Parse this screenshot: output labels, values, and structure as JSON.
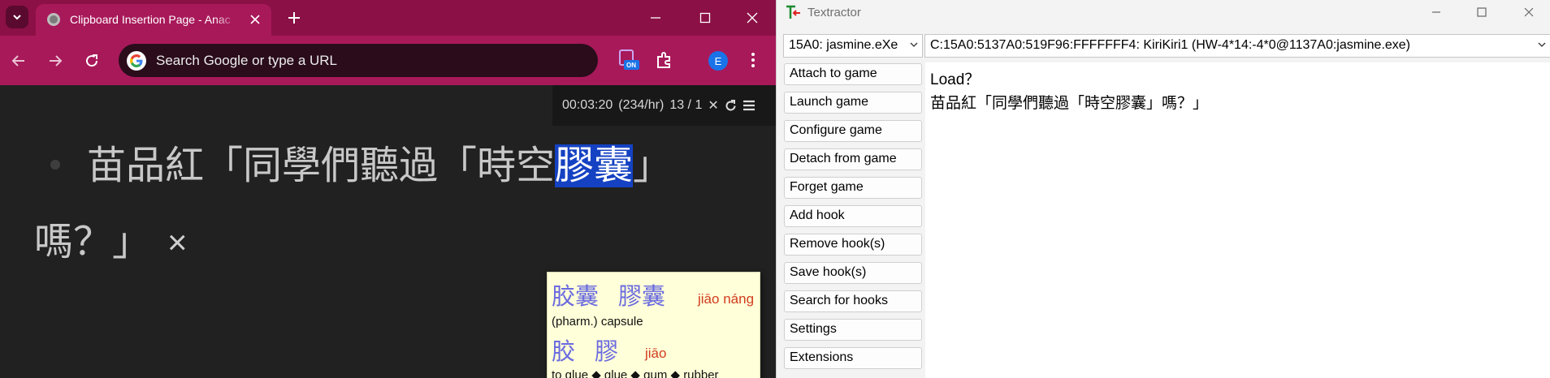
{
  "browser": {
    "tab_title": "Clipboard Insertion Page - Anac",
    "omnibox_placeholder": "Search Google or type a URL",
    "ext_badge": "ON",
    "avatar_initial": "E",
    "status": {
      "timer": "00:03:20",
      "rate": "(234/hr)",
      "count": "13 / 1"
    },
    "line1_before": "苗品紅「同學們聽過「時空",
    "line1_selected": "膠囊",
    "line1_after": "」",
    "line2": "嗎？」",
    "close_symbol": "×",
    "popup": {
      "entry1": {
        "simplified": "胶囊",
        "traditional": "膠囊",
        "pinyin1": "jiāo",
        "pinyin2": "náng",
        "definition": "(pharm.) capsule"
      },
      "entry2": {
        "simplified": "胶",
        "traditional": "膠",
        "pinyin1": "jiāo",
        "definition": "to glue ◆ glue ◆ gum ◆ rubber"
      }
    }
  },
  "textractor": {
    "title": "Textractor",
    "process_selected": "15A0: jasmine.eXe",
    "thread_selected": "C:15A0:5137A0:519F96:FFFFFFF4: KiriKiri1 (HW-4*14:-4*0@1137A0:jasmine.exe)",
    "buttons": [
      "Attach to game",
      "Launch game",
      "Configure game",
      "Detach from game",
      "Forget game",
      "Add hook",
      "Remove hook(s)",
      "Save hook(s)",
      "Search for hooks",
      "Settings",
      "Extensions"
    ],
    "text_lines": [
      "Load？",
      "苗品紅「同學們聽過「時空膠囊」嗎？」"
    ]
  },
  "colors": {
    "browser_frame": "#8b1046",
    "browser_toolbar": "#a8195a",
    "page_bg": "#212121",
    "selection": "#1542c2",
    "popup_bg": "#ffffd9",
    "popup_word": "#6a6ae0",
    "popup_pinyin": "#d23c1f"
  },
  "icons": [
    "chevron-down-icon",
    "close-icon",
    "plus-icon",
    "minimize-icon",
    "maximize-icon",
    "back-icon",
    "forward-icon",
    "reload-icon",
    "google-icon",
    "extension-on-icon",
    "puzzle-icon",
    "kebab-icon",
    "refresh-icon",
    "hamburger-icon",
    "textractor-logo-icon"
  ]
}
